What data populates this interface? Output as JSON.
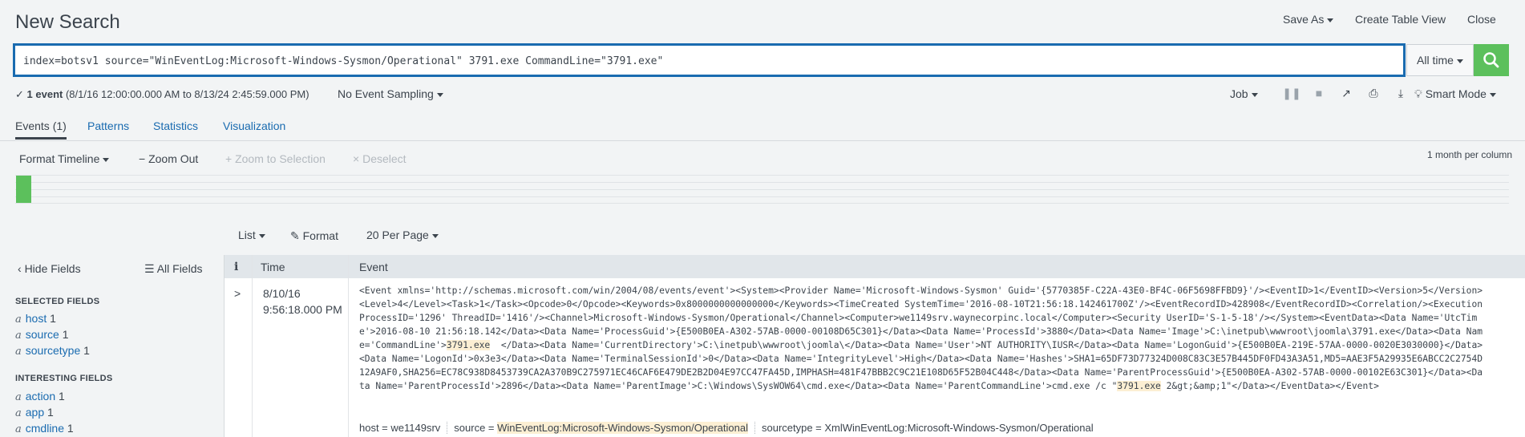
{
  "header": {
    "title": "New Search",
    "save_as": "Save As",
    "create_table_view": "Create Table View",
    "close": "Close"
  },
  "search": {
    "query": "index=botsv1 source=\"WinEventLog:Microsoft-Windows-Sysmon/Operational\" 3791.exe CommandLine=\"3791.exe\"",
    "time_range": "All time",
    "button_icon": "magnifier-icon"
  },
  "status": {
    "check": "✓",
    "count": "1 event",
    "range": "(8/1/16 12:00:00.000 AM to 8/13/24 2:45:59.000 PM)",
    "sampling": "No Event Sampling",
    "job": "Job",
    "smart_mode": "Smart Mode"
  },
  "tabs": [
    {
      "label": "Events (1)",
      "active": true
    },
    {
      "label": "Patterns",
      "active": false
    },
    {
      "label": "Statistics",
      "active": false
    },
    {
      "label": "Visualization",
      "active": false
    }
  ],
  "timeline": {
    "format": "Format Timeline",
    "zoom_out": "Zoom Out",
    "zoom_selection": "Zoom to Selection",
    "deselect": "Deselect",
    "scale": "1 month per column"
  },
  "results_controls": {
    "list": "List",
    "format": "Format",
    "per_page": "20 Per Page"
  },
  "sidebar": {
    "hide_fields": "Hide Fields",
    "all_fields": "All Fields",
    "selected_heading": "SELECTED FIELDS",
    "selected": [
      {
        "type": "a",
        "name": "host",
        "count": "1"
      },
      {
        "type": "a",
        "name": "source",
        "count": "1"
      },
      {
        "type": "a",
        "name": "sourcetype",
        "count": "1"
      }
    ],
    "interesting_heading": "INTERESTING FIELDS",
    "interesting": [
      {
        "type": "a",
        "name": "action",
        "count": "1"
      },
      {
        "type": "a",
        "name": "app",
        "count": "1"
      },
      {
        "type": "a",
        "name": "cmdline",
        "count": "1"
      }
    ]
  },
  "table": {
    "col_info": "i",
    "col_time": "Time",
    "col_event": "Event"
  },
  "event": {
    "date": "8/10/16",
    "time": "9:56:18.000 PM",
    "lines": [
      [
        "<Event xmlns='http://schemas.microsoft.com/win/2004/08/events/event'><System><Provider Name='Microsoft-Windows-Sysmon' Guid='{5770385F-C22A-43E0-BF4C-06F5698FFBD9}'/><EventID>1</EventID><Version>5</Version>"
      ],
      [
        "<Level>4</Level><Task>1</Task><Opcode>0</Opcode><Keywords>0x8000000000000000</Keywords><TimeCreated SystemTime='2016-08-10T21:56:18.142461700Z'/><EventRecordID>428908</EventRecordID><Correlation/><Execution"
      ],
      [
        "ProcessID='1296' ThreadID='1416'/><Channel>Microsoft-Windows-Sysmon/Operational</Channel><Computer>we1149srv.waynecorpinc.local</Computer><Security UserID='S-1-5-18'/></System><EventData><Data Name='UtcTim"
      ],
      [
        "e'>2016-08-10 21:56:18.142</Data><Data Name='ProcessGuid'>{E500B0EA-A302-57AB-0000-00108D65C301}</Data><Data Name='ProcessId'>3880</Data><Data Name='Image'>C:\\inetpub\\wwwroot\\joomla\\3791.exe</Data><Data Nam"
      ],
      [
        "e='CommandLine'>",
        "3791.exe",
        "  </Data><Data Name='CurrentDirectory'>C:\\inetpub\\wwwroot\\joomla\\</Data><Data Name='User'>NT AUTHORITY\\IUSR</Data><Data Name='LogonGuid'>{E500B0EA-219E-57AA-0000-0020E3030000}</Data>"
      ],
      [
        "<Data Name='LogonId'>0x3e3</Data><Data Name='TerminalSessionId'>0</Data><Data Name='IntegrityLevel'>High</Data><Data Name='Hashes'>SHA1=65DF73D77324D008C83C3E57B445DF0FD43A3A51,MD5=AAE3F5A29935E6ABCC2C2754D"
      ],
      [
        "12A9AF0,SHA256=EC78C938D8453739CA2A370B9C275971EC46CAF6E479DE2B2D04E97CC47FA45D,IMPHASH=481F47BBB2C9C21E108D65F52B04C448</Data><Data Name='ParentProcessGuid'>{E500B0EA-A302-57AB-0000-00102E63C301}</Data><Da"
      ],
      [
        "ta Name='ParentProcessId'>2896</Data><Data Name='ParentImage'>C:\\Windows\\SysWOW64\\cmd.exe</Data><Data Name='ParentCommandLine'>cmd.exe /c \"",
        "3791.exe",
        " 2&gt;&amp;1\"</Data></EventData></Event>"
      ]
    ],
    "fields": [
      {
        "key": "host",
        "value": "we1149srv",
        "highlight": false
      },
      {
        "key": "source",
        "value": "WinEventLog:Microsoft-Windows-Sysmon/Operational",
        "highlight": true
      },
      {
        "key": "sourcetype",
        "value": "XmlWinEventLog:Microsoft-Windows-Sysmon/Operational",
        "highlight": false
      }
    ]
  },
  "colors": {
    "accent": "#1a6bb0",
    "go": "#5cc05c",
    "highlight": "#fcefd3"
  }
}
